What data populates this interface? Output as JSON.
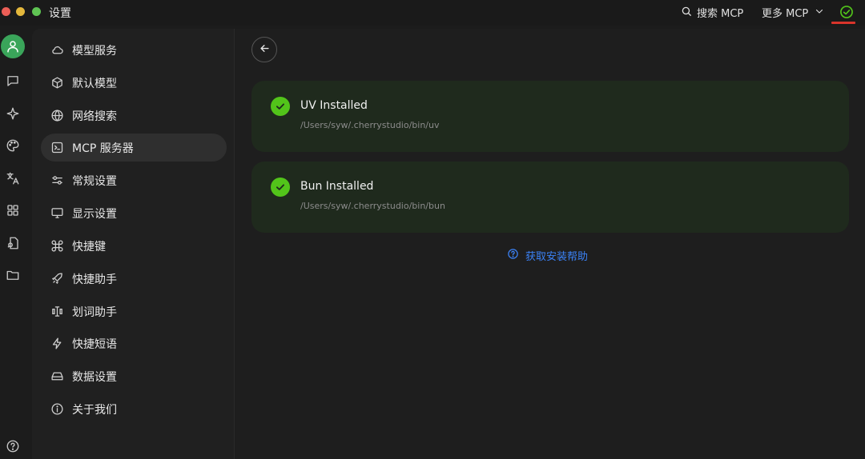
{
  "window": {
    "title": "设置"
  },
  "topbar": {
    "search_label": "搜索 MCP",
    "more_label": "更多 MCP"
  },
  "menu": {
    "items": [
      {
        "label": "模型服务",
        "icon": "cloud-icon"
      },
      {
        "label": "默认模型",
        "icon": "cube-icon"
      },
      {
        "label": "网络搜索",
        "icon": "globe-icon"
      },
      {
        "label": "MCP 服务器",
        "icon": "terminal-icon",
        "active": true
      },
      {
        "label": "常规设置",
        "icon": "settings-sliders-icon"
      },
      {
        "label": "显示设置",
        "icon": "monitor-icon"
      },
      {
        "label": "快捷键",
        "icon": "command-icon"
      },
      {
        "label": "快捷助手",
        "icon": "rocket-icon"
      },
      {
        "label": "划词助手",
        "icon": "text-select-icon"
      },
      {
        "label": "快捷短语",
        "icon": "zap-icon"
      },
      {
        "label": "数据设置",
        "icon": "hard-drive-icon"
      },
      {
        "label": "关于我们",
        "icon": "info-icon"
      }
    ]
  },
  "cards": [
    {
      "title": "UV Installed",
      "path": "/Users/syw/.cherrystudio/bin/uv"
    },
    {
      "title": "Bun Installed",
      "path": "/Users/syw/.cherrystudio/bin/bun"
    }
  ],
  "help": {
    "label": "获取安装帮助"
  },
  "colors": {
    "accent_green": "#52c41a",
    "link_blue": "#3b82f6",
    "highlight_red": "#d9342b"
  }
}
